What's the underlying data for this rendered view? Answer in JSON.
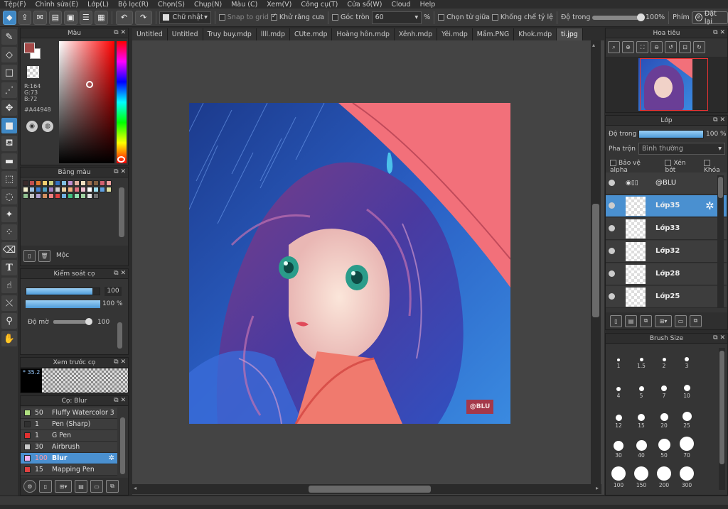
{
  "menu": [
    "Tệp(F)",
    "Chỉnh sửa(E)",
    "Lớp(L)",
    "Bộ lọc(R)",
    "Chọn(S)",
    "Chụp(N)",
    "Màu (C)",
    "Xem(V)",
    "Công cụ(T)",
    "Cửa sổ(W)",
    "Cloud",
    "Help"
  ],
  "toolbar": {
    "shape_select": "Chữ nhật",
    "snap": "Snap to grid",
    "antialias": "Khử răng cưa",
    "round_corner": "Góc tròn",
    "round_value": "60",
    "percent": "%",
    "center_select": "Chọn từ giữa",
    "fix_ratio": "Khống chế tỷ lệ",
    "opacity_label": "Độ trong",
    "opacity_value": "100%",
    "keys_label": "Phím",
    "reset_label": "Đặt lại"
  },
  "tabs": [
    "Untitled",
    "Untitled",
    "Truy buy.mdp",
    "llll.mdp",
    "CUte.mdp",
    "Hoàng hôn.mdp",
    "Xênh.mdp",
    "Yêi.mdp",
    "Mầm.PNG",
    "Khok.mdp",
    "ti.jpg"
  ],
  "color_panel": {
    "title": "Màu",
    "r": "R:164",
    "g": "G:73",
    "b": "B:72",
    "hex": "#A44948",
    "fg_color": "#a44948"
  },
  "palette": {
    "title": "Bảng màu",
    "footer_label": "Mộc",
    "colors": [
      "#3a2a2a",
      "#c05050",
      "#e07a30",
      "#efd070",
      "#c8d080",
      "#3070c0",
      "#80c0e0",
      "#c090d0",
      "#e0b0a0",
      "#f0e0c0",
      "#a07050",
      "#806040",
      "#d06070",
      "#f0a0a0",
      "#f5f0d0",
      "#a0c0e0",
      "#4080d0",
      "#50a0c0",
      "#a080c0",
      "#d0d0d0",
      "#e8d0a0",
      "#f0b080",
      "#e07080",
      "#f0c0d0",
      "#ffffff",
      "#a0e0f0",
      "#60a0e0",
      "#e0e0a0",
      "#90c090",
      "#c0c0c0",
      "#b0a0d0",
      "#d09060",
      "#f08080",
      "#e04040",
      "#70b0e0",
      "#40c080",
      "#90e0b0",
      "#a0d0a0",
      "#e0e0e0",
      "#707070"
    ]
  },
  "brush_control": {
    "title": "Kiểm soát cọ",
    "size_value": "100",
    "size_fraction": 0.9,
    "opacity_value": "100 %",
    "blur_label": "Độ mờ",
    "blur_value": "100"
  },
  "preview": {
    "title": "Xem trước cọ",
    "size": "35.2"
  },
  "brush_list": {
    "title": "Cọ: Blur",
    "items": [
      {
        "num": "50",
        "name": "Fluffy Watercolor 3",
        "color": "#b0e080"
      },
      {
        "num": "1",
        "name": "Pen (Sharp)",
        "color": "#303030"
      },
      {
        "num": "1",
        "name": "G Pen",
        "color": "#e03030"
      },
      {
        "num": "30",
        "name": "Airbrush",
        "color": "#c8c8c8"
      },
      {
        "num": "100",
        "name": "Blur",
        "color": "#f0b0f0"
      },
      {
        "num": "15",
        "name": "Mapping Pen",
        "color": "#e04040"
      }
    ]
  },
  "navigator": {
    "title": "Hoa tiêu"
  },
  "layers": {
    "title": "Lớp",
    "opacity_label": "Độ trong",
    "opacity_value": "100 %",
    "blend_label": "Pha trộn",
    "blend_value": "Bình thường",
    "protect_alpha": "Bảo vệ alpha",
    "clip": "Xén bớt",
    "lock": "Khóa",
    "items": [
      {
        "name": "@BLU"
      },
      {
        "name": "Lớp35"
      },
      {
        "name": "Lớp33"
      },
      {
        "name": "Lớp32"
      },
      {
        "name": "Lớp28"
      },
      {
        "name": "Lớp25"
      }
    ]
  },
  "brush_size": {
    "title": "Brush Size",
    "sizes": [
      "1",
      "1.5",
      "2",
      "3",
      "4",
      "5",
      "7",
      "10",
      "12",
      "15",
      "20",
      "25",
      "30",
      "40",
      "50",
      "70",
      "100",
      "150",
      "200",
      "300"
    ]
  },
  "artwork": {
    "watermark": "@BLU"
  }
}
